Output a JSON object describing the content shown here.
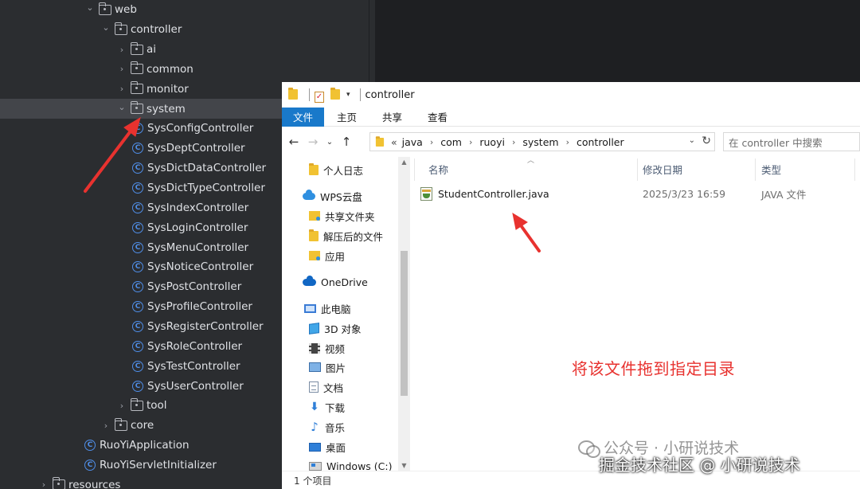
{
  "ide_tree": {
    "rows": [
      {
        "label": "web",
        "kind": "folder",
        "expanded": true
      },
      {
        "label": "controller",
        "kind": "folder",
        "expanded": true
      },
      {
        "label": "ai",
        "kind": "folder",
        "expanded": false
      },
      {
        "label": "common",
        "kind": "folder",
        "expanded": false
      },
      {
        "label": "monitor",
        "kind": "folder",
        "expanded": false
      },
      {
        "label": "system",
        "kind": "folder",
        "expanded": true,
        "selected": true
      },
      {
        "label": "SysConfigController",
        "kind": "class"
      },
      {
        "label": "SysDeptController",
        "kind": "class"
      },
      {
        "label": "SysDictDataController",
        "kind": "class"
      },
      {
        "label": "SysDictTypeController",
        "kind": "class"
      },
      {
        "label": "SysIndexController",
        "kind": "class"
      },
      {
        "label": "SysLoginController",
        "kind": "class"
      },
      {
        "label": "SysMenuController",
        "kind": "class"
      },
      {
        "label": "SysNoticeController",
        "kind": "class"
      },
      {
        "label": "SysPostController",
        "kind": "class"
      },
      {
        "label": "SysProfileController",
        "kind": "class"
      },
      {
        "label": "SysRegisterController",
        "kind": "class"
      },
      {
        "label": "SysRoleController",
        "kind": "class"
      },
      {
        "label": "SysTestController",
        "kind": "class"
      },
      {
        "label": "SysUserController",
        "kind": "class"
      },
      {
        "label": "tool",
        "kind": "folder",
        "expanded": false
      },
      {
        "label": "core",
        "kind": "folder",
        "expanded": false
      },
      {
        "label": "RuoYiApplication",
        "kind": "app-class"
      },
      {
        "label": "RuoYiServletInitializer",
        "kind": "class"
      },
      {
        "label": "resources",
        "kind": "folder",
        "expanded": false
      }
    ]
  },
  "explorer": {
    "title": "controller",
    "ribbon_tabs": [
      "文件",
      "主页",
      "共享",
      "查看"
    ],
    "breadcrumb_prefix": "«",
    "breadcrumb": [
      "java",
      "com",
      "ruoyi",
      "system",
      "controller"
    ],
    "search_placeholder": "在 controller 中搜索",
    "nav_items": [
      {
        "label": "个人日志",
        "icon": "folder-icon"
      },
      {
        "label": "WPS云盘",
        "icon": "cloud-icon"
      },
      {
        "label": "共享文件夹",
        "icon": "shared-folder-icon"
      },
      {
        "label": "解压后的文件",
        "icon": "folder-icon"
      },
      {
        "label": "应用",
        "icon": "shared-folder-icon"
      },
      {
        "label": "OneDrive",
        "icon": "onedrive-icon"
      },
      {
        "label": "此电脑",
        "icon": "computer-icon"
      },
      {
        "label": "3D 对象",
        "icon": "cube-icon"
      },
      {
        "label": "视频",
        "icon": "video-icon"
      },
      {
        "label": "图片",
        "icon": "picture-icon"
      },
      {
        "label": "文档",
        "icon": "document-icon"
      },
      {
        "label": "下载",
        "icon": "download-icon"
      },
      {
        "label": "音乐",
        "icon": "music-icon"
      },
      {
        "label": "桌面",
        "icon": "desktop-icon"
      },
      {
        "label": "Windows (C:)",
        "icon": "drive-icon"
      }
    ],
    "columns": {
      "name": "名称",
      "date": "修改日期",
      "type": "类型"
    },
    "files": [
      {
        "name": "StudentController.java",
        "date": "2025/3/23 16:59",
        "type": "JAVA 文件"
      }
    ],
    "status": "1 个项目"
  },
  "annotation": "将该文件拖到指定目录",
  "watermark": "公众号 · 小研说技术",
  "credit": "掘金技术社区 @ 小研说技术",
  "colors": {
    "annotation_red": "#e8322f",
    "ide_bg": "#2b2d30",
    "ide_selected": "#43454a",
    "class_icon": "#4f8ee8",
    "ribbon_file_tab": "#1979ca"
  }
}
